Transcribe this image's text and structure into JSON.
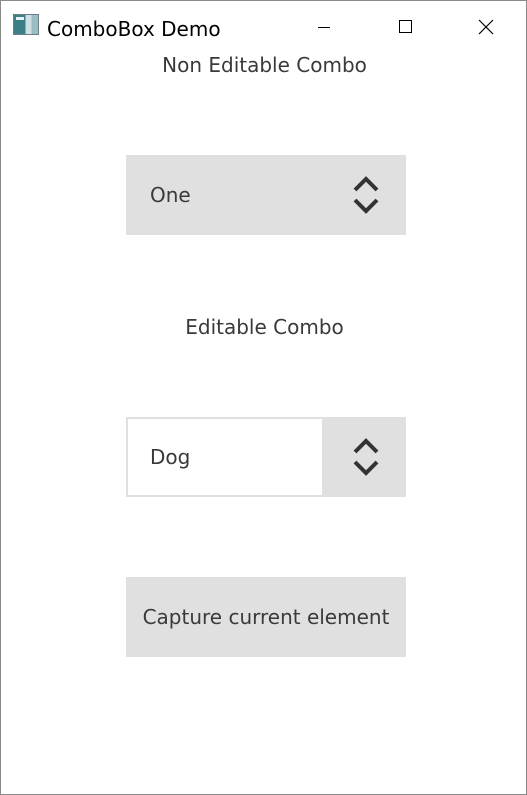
{
  "window": {
    "title": "ComboBox Demo",
    "controls": [
      "minimize-icon",
      "maximize-icon",
      "close-icon"
    ]
  },
  "non_editable": {
    "label": "Non Editable Combo",
    "selected_value": "One",
    "icon": "chevron-up-down-icon"
  },
  "editable": {
    "label": "Editable Combo",
    "value": "Dog",
    "icon": "chevron-up-down-icon"
  },
  "capture_button": {
    "label": "Capture current element"
  },
  "colors": {
    "control_bg": "#e0e0e0",
    "text": "#3a3a3a"
  }
}
